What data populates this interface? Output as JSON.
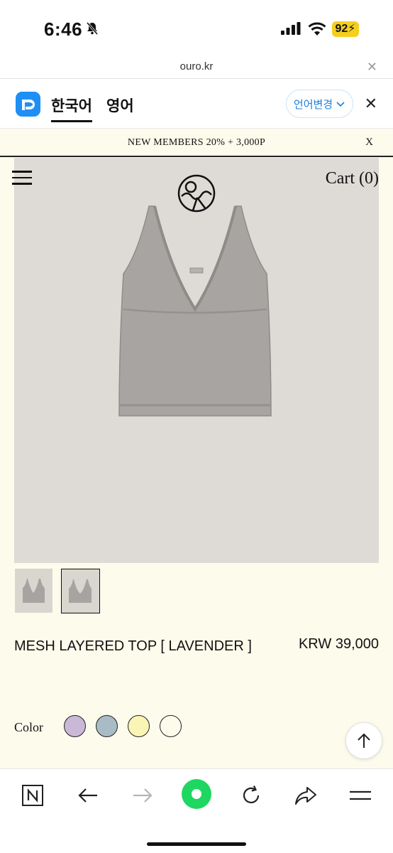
{
  "status_bar": {
    "time": "6:46",
    "battery": "92"
  },
  "browser": {
    "url": "ouro.kr"
  },
  "translate_bar": {
    "korean_tab": "한국어",
    "english_tab": "영어",
    "change_language": "언어변경"
  },
  "promo": {
    "text": "NEW MEMBERS 20% + 3,000P",
    "close": "X"
  },
  "header": {
    "cart": "Cart (0)"
  },
  "product": {
    "name": "MESH LAYERED TOP [ LAVENDER ]",
    "price": "KRW 39,000",
    "color_label": "Color",
    "swatches": [
      {
        "name": "lavender",
        "color": "#c9b8d6"
      },
      {
        "name": "blue-grey",
        "color": "#a9bcc6"
      },
      {
        "name": "yellow",
        "color": "#fbf5b5"
      },
      {
        "name": "ivory",
        "color": "#fdfbec"
      }
    ]
  },
  "colors": {
    "background": "#fdfbec",
    "image_bg": "#dedad5",
    "accent": "#1c7fdc",
    "go_button": "#1ed760"
  }
}
